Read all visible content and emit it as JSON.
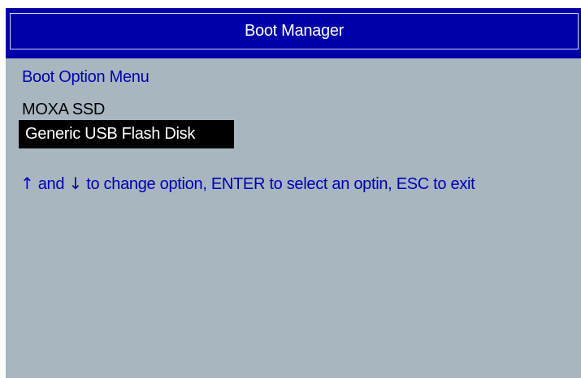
{
  "header": {
    "title": "Boot Manager"
  },
  "menu": {
    "heading": "Boot Option Menu",
    "items": [
      {
        "label": "MOXA SSD",
        "selected": false
      },
      {
        "label": "Generic USB Flash Disk",
        "selected": true
      }
    ]
  },
  "help": {
    "up_arrow": "↑",
    "and_text": "and",
    "down_arrow": "↓",
    "rest_text": "to change option, ENTER to select an optin, ESC to exit"
  },
  "colors": {
    "title_bar": "#0000a8",
    "background": "#a8b6bf",
    "accent_text": "#0000b4",
    "selection": "#000000"
  }
}
